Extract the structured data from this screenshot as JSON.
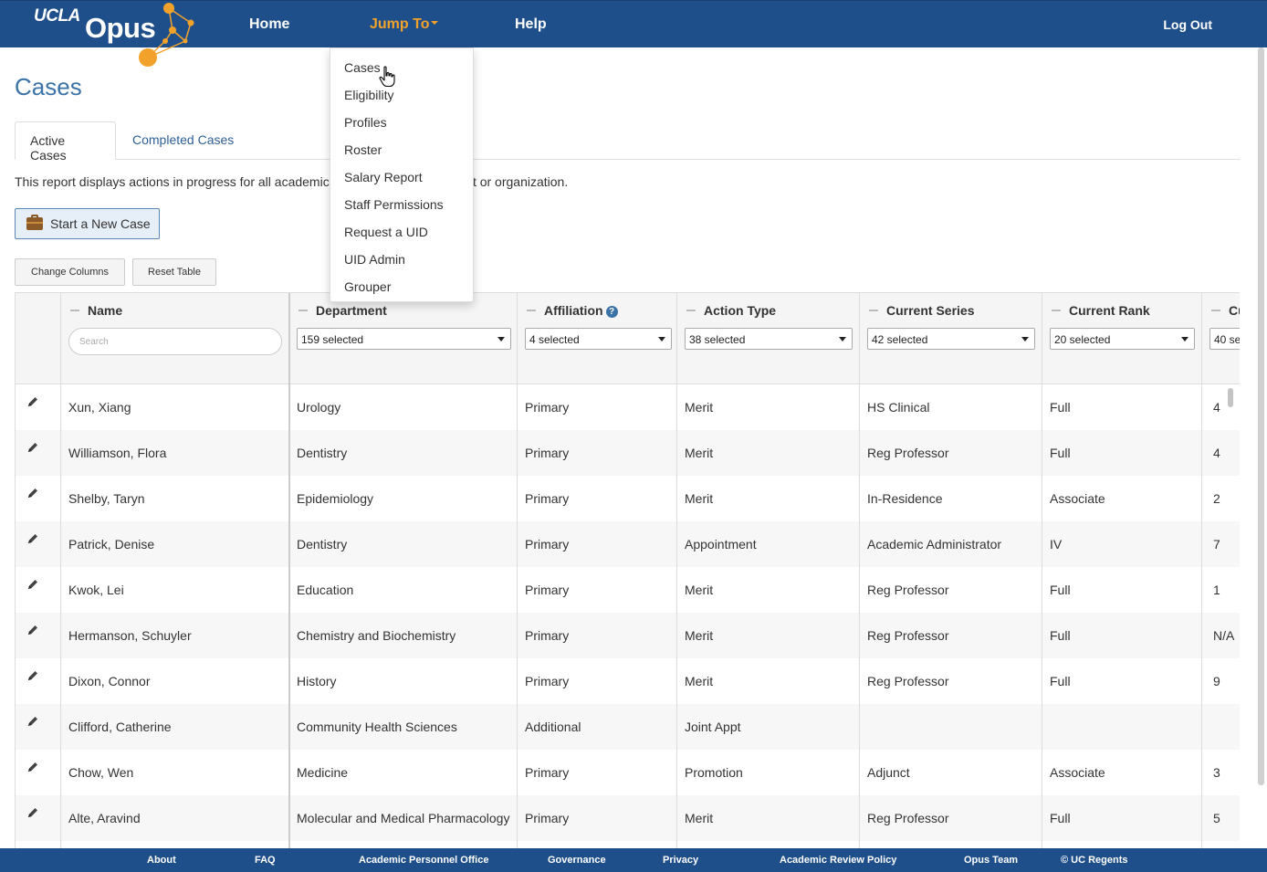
{
  "nav": {
    "logo_ucla": "UCLA",
    "logo_opus": "Opus",
    "home": "Home",
    "jump_to": "Jump To",
    "help": "Help",
    "log_out": "Log Out",
    "accent_color": "#f2a22a",
    "bar_color": "#1f4f8b"
  },
  "dropdown": {
    "items": [
      "Cases",
      "Eligibility",
      "Profiles",
      "Roster",
      "Salary Report",
      "Staff Permissions",
      "Request a UID",
      "UID Admin",
      "Grouper"
    ]
  },
  "page": {
    "title": "Cases",
    "tabs": [
      "Active Cases",
      "Completed Cases"
    ],
    "description_left": "This report displays actions in progress for all academic",
    "description_right": "ment or organization.",
    "start_case": "Start a New Case",
    "change_columns": "Change Columns",
    "reset_table": "Reset Table"
  },
  "table": {
    "columns": [
      {
        "label": "Name"
      },
      {
        "label": "Department",
        "filter": "159 selected"
      },
      {
        "label": "Affiliation",
        "filter": "4 selected"
      },
      {
        "label": "Action Type",
        "filter": "38 selected"
      },
      {
        "label": "Current Series",
        "filter": "42 selected"
      },
      {
        "label": "Current Rank",
        "filter": "20 selected"
      },
      {
        "label": "Cu",
        "filter": "40 se"
      }
    ],
    "search_placeholder": "Search",
    "help_icon": "?",
    "rows": [
      [
        "Xun, Xiang",
        "Urology",
        "Primary",
        "Merit",
        "HS Clinical",
        "Full",
        "4"
      ],
      [
        "Williamson, Flora",
        "Dentistry",
        "Primary",
        "Merit",
        "Reg Professor",
        "Full",
        "4"
      ],
      [
        "Shelby, Taryn",
        "Epidemiology",
        "Primary",
        "Merit",
        "In-Residence",
        "Associate",
        "2"
      ],
      [
        "Patrick, Denise",
        "Dentistry",
        "Primary",
        "Appointment",
        "Academic Administrator",
        "IV",
        "7"
      ],
      [
        "Kwok, Lei",
        "Education",
        "Primary",
        "Merit",
        "Reg Professor",
        "Full",
        "1"
      ],
      [
        "Hermanson, Schuyler",
        "Chemistry and Biochemistry",
        "Primary",
        "Merit",
        "Reg Professor",
        "Full",
        "N/A"
      ],
      [
        "Dixon, Connor",
        "History",
        "Primary",
        "Merit",
        "Reg Professor",
        "Full",
        "9"
      ],
      [
        "Clifford, Catherine",
        "Community Health Sciences",
        "Additional",
        "Joint Appt",
        "",
        "",
        ""
      ],
      [
        "Chow, Wen",
        "Medicine",
        "Primary",
        "Promotion",
        "Adjunct",
        "Associate",
        "3"
      ],
      [
        "Alte, Aravind",
        "Molecular and Medical Pharmacology",
        "Primary",
        "Merit",
        "Reg Professor",
        "Full",
        "5"
      ]
    ]
  },
  "footer": {
    "links": [
      "About",
      "FAQ",
      "Academic Personnel Office",
      "Governance",
      "Privacy",
      "Academic Review Policy",
      "Opus Team",
      "© UC Regents"
    ]
  }
}
